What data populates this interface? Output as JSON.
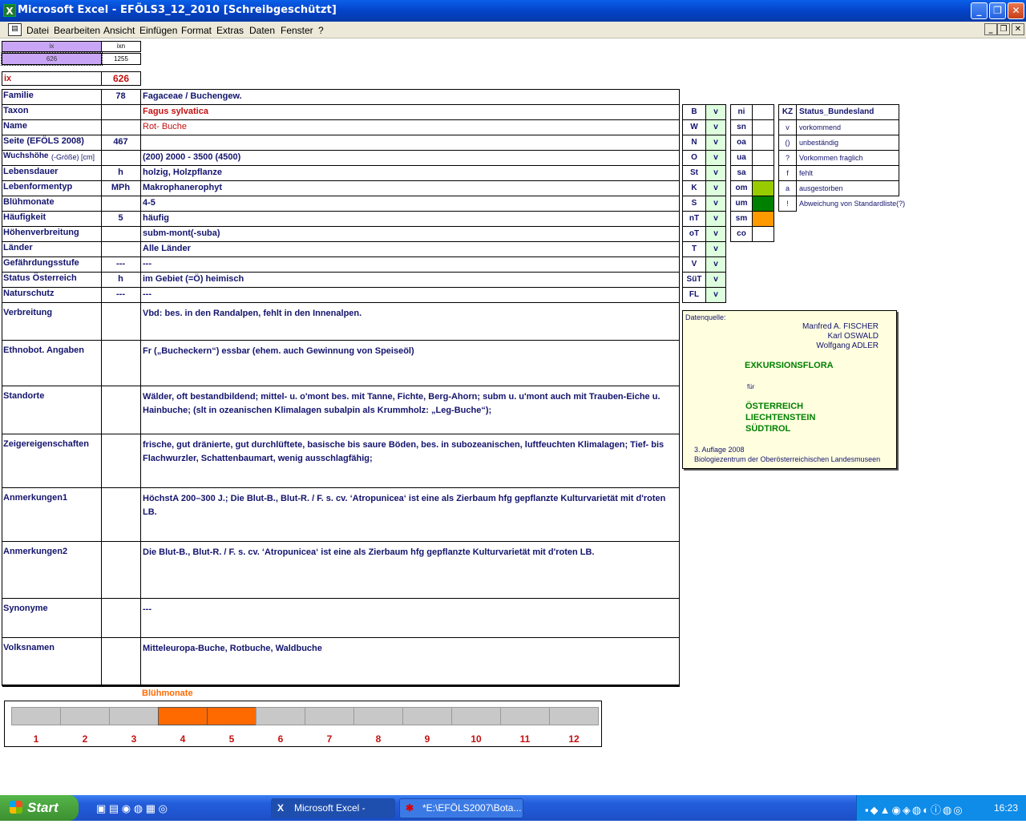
{
  "window": {
    "title": "Microsoft Excel - EFÖLS3_12_2010  [Schreibgeschützt]",
    "app_icon": "X"
  },
  "menu": [
    "Datei",
    "Bearbeiten",
    "Ansicht",
    "Einfügen",
    "Format",
    "Extras",
    "Daten",
    "Fenster",
    "?"
  ],
  "top": {
    "ix_hdr": "ix",
    "ixn_hdr": "ixn",
    "ix_val": "626",
    "ixn_val": "1255",
    "ix_label": "ix",
    "ix_big": "626"
  },
  "rows": [
    {
      "label": "Familie",
      "code": "78",
      "value": "Fagaceae  /  Buchengew."
    },
    {
      "label": "Taxon",
      "code": "",
      "value": "Fagus sylvatica"
    },
    {
      "label": "Name",
      "code": "",
      "value": "Rot- Buche"
    },
    {
      "label": "Seite (EFÖLS 2008)",
      "code": "467",
      "value": ""
    },
    {
      "label": "Wuchshöhe",
      "label_suffix": "(-Größe) [cm]",
      "code": "",
      "value": "(200) 2000 - 3500 (4500)"
    },
    {
      "label": "Lebensdauer",
      "code": "h",
      "value": "holzig, Holzpflanze"
    },
    {
      "label": "Lebenformentyp",
      "code": "MPh",
      "value": "Makrophanerophyt"
    },
    {
      "label": "Blühmonate",
      "code": "",
      "value": "4-5"
    },
    {
      "label": "Häufigkeit",
      "code": "5",
      "value": "häufig"
    },
    {
      "label": "Höhenverbreitung",
      "code": "",
      "value": "subm-mont(-suba)"
    },
    {
      "label": "Länder",
      "code": "",
      "value": "Alle Länder"
    },
    {
      "label": "Gefährdungsstufe",
      "code": "---",
      "value": "---"
    },
    {
      "label": "Status Österreich",
      "code": "h",
      "value": "im Gebiet (=Ö) heimisch"
    },
    {
      "label": "Naturschutz",
      "code": "---",
      "value": "---"
    }
  ],
  "text_rows": [
    {
      "label": "Verbreitung",
      "value": "Vbd: bes. in den Randalpen, fehlt in den Innenalpen."
    },
    {
      "label": "Ethnobot. Angaben",
      "value": " Fr („Bucheckern“) essbar (ehem. auch Gewinnung von Speiseöl)"
    },
    {
      "label": "Standorte",
      "value": "Wälder, oft bestandbildend; mittel- u. o'mont bes. mit Tanne, Fichte, Berg-Ahorn; subm u. u'mont auch mit Trauben-Eiche u. Hainbuche; (slt in ozeanischen Klimalagen subalpin als Krummholz: „Leg-Buche“);"
    },
    {
      "label": "Zeigereigenschaften",
      "value": "frische, gut dränierte, gut durchlüftete, basische bis saure Böden, bes. in subozeanischen, luftfeuchten Klimalagen; Tief- bis Flachwurzler, Schattenbaumart, wenig ausschlagfähig;"
    },
    {
      "label": "Anmerkungen1",
      "value": "HöchstA 200–300 J.; Die Blut-B., Blut-R. / F. s. cv. ‘Atropunicea‘ ist eine als Zierbaum hfg gepflanzte Kulturvarietät mit d'roten LB."
    },
    {
      "label": "Anmerkungen2",
      "value": "Die  Blut-B., Blut-R. / F. s. cv. ‘Atropunicea‘ ist eine als Zierbaum hfg gepflanzte Kulturvarietät mit d'roten LB."
    },
    {
      "label": "Synonyme",
      "value": "---"
    },
    {
      "label": "Volksnamen",
      "value": "Mitteleuropa-Buche, Rotbuche, Waldbuche"
    }
  ],
  "regions": [
    {
      "code": "B",
      "v": "v"
    },
    {
      "code": "W",
      "v": "v"
    },
    {
      "code": "N",
      "v": "v"
    },
    {
      "code": "O",
      "v": "v"
    },
    {
      "code": "St",
      "v": "v"
    },
    {
      "code": "K",
      "v": "v"
    },
    {
      "code": "S",
      "v": "v"
    },
    {
      "code": "nT",
      "v": "v"
    },
    {
      "code": "oT",
      "v": "v"
    },
    {
      "code": "T",
      "v": "v"
    },
    {
      "code": "V",
      "v": "v"
    },
    {
      "code": "SüT",
      "v": "v"
    },
    {
      "code": "FL",
      "v": "v"
    }
  ],
  "zones": [
    {
      "code": "ni",
      "fill": ""
    },
    {
      "code": "sn",
      "fill": ""
    },
    {
      "code": "oa",
      "fill": ""
    },
    {
      "code": "ua",
      "fill": ""
    },
    {
      "code": "sa",
      "fill": ""
    },
    {
      "code": "om",
      "fill": "#99cc00"
    },
    {
      "code": "um",
      "fill": "#008000"
    },
    {
      "code": "sm",
      "fill": "#ff9900"
    },
    {
      "code": "co",
      "fill": ""
    }
  ],
  "legend": {
    "kz": "KZ",
    "title": "Status_Bundesland",
    "items": [
      {
        "k": "v",
        "t": "vorkommend"
      },
      {
        "k": "()",
        "t": "unbeständig"
      },
      {
        "k": "?",
        "t": "Vorkommen fraglich"
      },
      {
        "k": "f",
        "t": "fehlt"
      },
      {
        "k": "a",
        "t": "ausgestorben"
      },
      {
        "k": "!",
        "t": "Abweichung von Standardliste(?)"
      }
    ]
  },
  "source": {
    "hdr": "Datenquelle:",
    "authors": [
      "Manfred A. FISCHER",
      "Karl OSWALD",
      "Wolfgang ADLER"
    ],
    "book": "EXKURSIONSFLORA",
    "fuer": "für",
    "countries": [
      "ÖSTERREICH",
      "LIECHTENSTEIN",
      "SÜDTIROL"
    ],
    "edition": "3. Auflage 2008",
    "publisher": "Biologiezentrum der Oberösterreichischen Landesmuseen"
  },
  "bloom": {
    "title": "Blühmonate",
    "months": [
      "1",
      "2",
      "3",
      "4",
      "5",
      "6",
      "7",
      "8",
      "9",
      "10",
      "11",
      "12"
    ],
    "active": [
      4,
      5
    ]
  },
  "taskbar": {
    "start": "Start",
    "btn1": "Microsoft Excel - EFÖ...",
    "btn2": "*E:\\EFÖLS2007\\Bota...",
    "clock": "16:23"
  },
  "colors": {
    "accent_orange": "#ff6a00",
    "label_blue": "#14146e",
    "red": "#c41010",
    "ix_purple": "#c9a6f5"
  }
}
